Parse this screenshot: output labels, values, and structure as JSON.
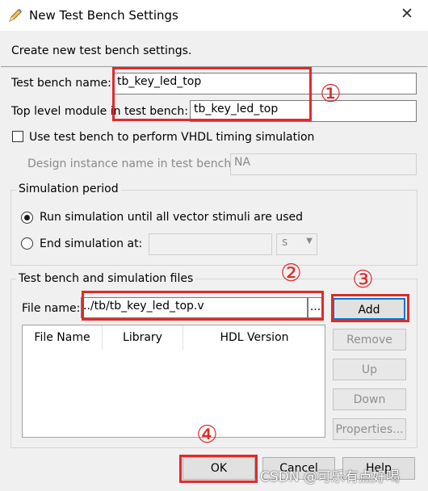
{
  "window": {
    "title": "New Test Bench Settings",
    "close": "✕"
  },
  "description": "Create new test bench settings.",
  "fields": {
    "tb_name_label": "Test bench name:",
    "tb_name_value": "tb_key_led_top",
    "top_module_label": "Top level module in test bench:",
    "top_module_value": "tb_key_led_top",
    "vhdl_checkbox_label": "Use test bench to perform VHDL timing simulation",
    "design_instance_label": "Design instance name in test bench:",
    "design_instance_value": "NA"
  },
  "simulation_period": {
    "title": "Simulation period",
    "run_all_label": "Run simulation until all vector stimuli are used",
    "end_at_label": "End simulation at:",
    "end_at_value": "",
    "unit": "s"
  },
  "files": {
    "title": "Test bench and simulation files",
    "file_name_label": "File name:",
    "file_name_value": "../tb/tb_key_led_top.v",
    "browse": "...",
    "columns": [
      "File Name",
      "Library",
      "HDL Version"
    ],
    "add": "Add",
    "remove": "Remove",
    "up": "Up",
    "down": "Down",
    "properties": "Properties..."
  },
  "footer": {
    "ok": "OK",
    "cancel": "Cancel",
    "help": "Help"
  },
  "annotations": [
    "①",
    "②",
    "③",
    "④"
  ],
  "watermark": "CSDN @可乐有点好喝",
  "colors": {
    "highlight_red": "#e02a2a",
    "focus_blue": "#0078d7"
  }
}
